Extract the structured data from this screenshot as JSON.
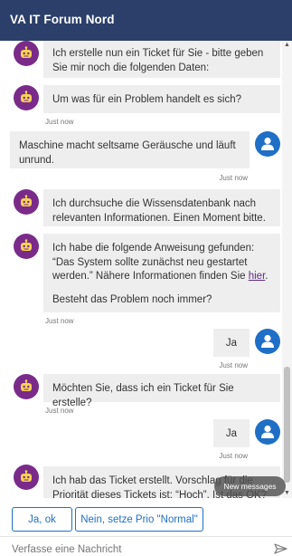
{
  "header": {
    "title": "VA IT Forum Nord"
  },
  "messages": [
    {
      "from": "bot",
      "text": "Ich erstelle nun ein Ticket für Sie - bitte geben Sie mir noch die folgenden Daten:",
      "timestamp": ""
    },
    {
      "from": "bot",
      "text": "Um was für ein Problem handelt es sich?",
      "timestamp": "Just now"
    },
    {
      "from": "user",
      "text": "Maschine macht seltsame Geräusche und läuft unrund.",
      "timestamp": "Just now"
    },
    {
      "from": "bot",
      "text": "Ich durchsuche die Wissensdatenbank nach relevanten Informationen. Einen Moment bitte.",
      "timestamp": ""
    },
    {
      "from": "bot",
      "text_part1": "Ich habe die folgende Anweisung gefunden: “Das System sollte zunächst neu gestartet werden.” Nähere Informationen finden Sie ",
      "link_text": "hier",
      "text_part2": ".",
      "text_line2": "Besteht das Problem noch immer?",
      "timestamp": "Just now"
    },
    {
      "from": "user",
      "text": "Ja",
      "timestamp": "Just now"
    },
    {
      "from": "bot",
      "text": "Möchten Sie, dass ich ein Ticket für Sie erstelle?",
      "timestamp": "Just now"
    },
    {
      "from": "user",
      "text": "Ja",
      "timestamp": "Just now"
    },
    {
      "from": "bot",
      "text": "Ich hab das Ticket erstellt. Vorschlag für die Priorität dieses Tickets ist: “Hoch”. Ist das OK?",
      "timestamp": ""
    }
  ],
  "new_messages_label": "New messages",
  "suggested_actions": [
    {
      "label": "Ja, ok"
    },
    {
      "label": "Nein, setze Prio \"Normal\""
    }
  ],
  "composer": {
    "placeholder": "Verfasse eine Nachricht"
  },
  "icons": {
    "bot_avatar": "bot-icon",
    "user_avatar": "user-icon",
    "send": "send-icon"
  },
  "colors": {
    "header_bg": "#2b3f6a",
    "bot_avatar": "#7a2b8a",
    "user_avatar": "#1f6fc6",
    "bubble_bg": "#eeeeee",
    "link": "#5e2a8e",
    "accent": "#1f6fc6"
  }
}
